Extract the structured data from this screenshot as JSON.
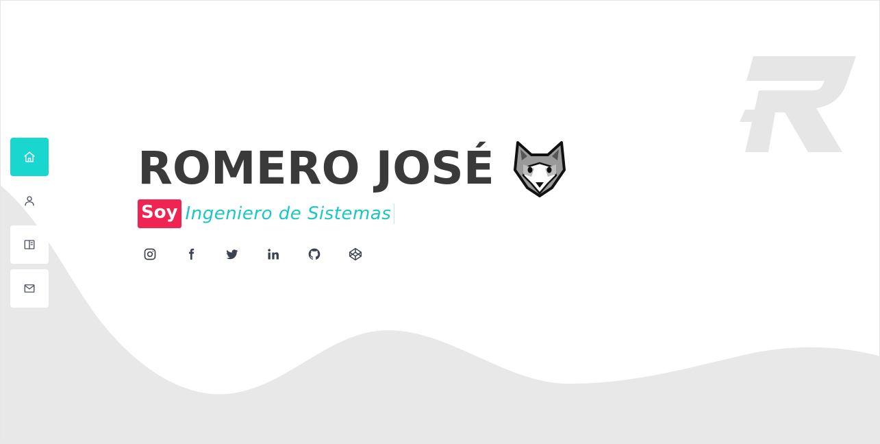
{
  "brand": {
    "logo_letter": "R"
  },
  "sidebar": {
    "items": [
      {
        "name": "home",
        "icon": "home-icon",
        "active": true
      },
      {
        "name": "about",
        "icon": "user-icon",
        "active": false
      },
      {
        "name": "portfolio",
        "icon": "book-icon",
        "active": false
      },
      {
        "name": "contact",
        "icon": "mail-icon",
        "active": false
      }
    ]
  },
  "hero": {
    "name": "ROMERO JOSÉ",
    "emoji": "wolf-face",
    "prefix": "Soy",
    "role": "Ingeniero de Sistemas"
  },
  "socials": [
    {
      "name": "instagram",
      "icon": "instagram-icon"
    },
    {
      "name": "facebook",
      "icon": "facebook-icon"
    },
    {
      "name": "twitter",
      "icon": "twitter-icon"
    },
    {
      "name": "linkedin",
      "icon": "linkedin-icon"
    },
    {
      "name": "github",
      "icon": "github-icon"
    },
    {
      "name": "codepen",
      "icon": "codepen-icon"
    }
  ],
  "colors": {
    "accent": "#19d6cf",
    "highlight": "#ef2453",
    "text_dark": "#3a3a3a",
    "wave": "#e8e8e8"
  }
}
